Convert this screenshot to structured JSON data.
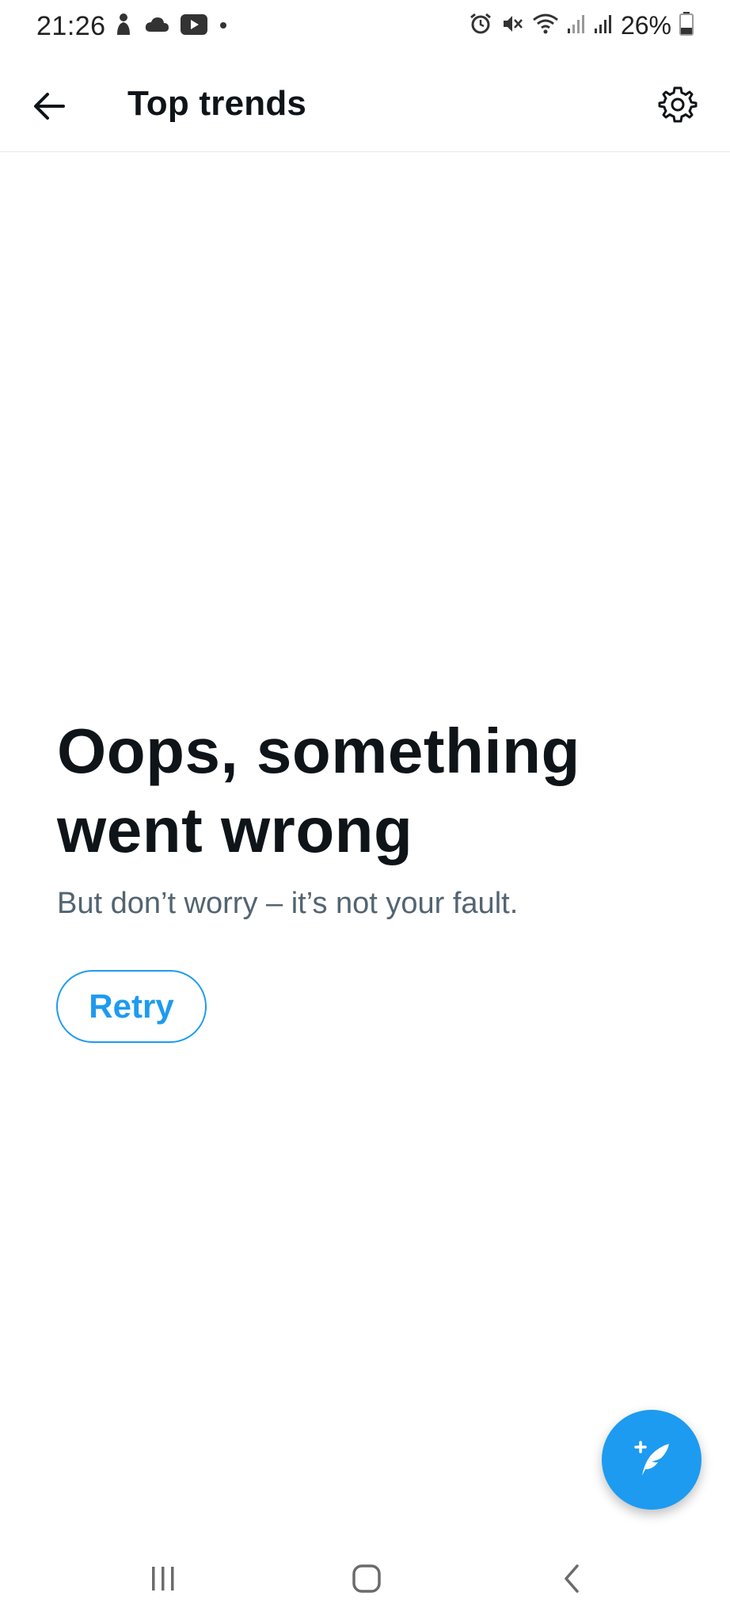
{
  "status_bar": {
    "time": "21:26",
    "battery": "26%",
    "left_icons": [
      "notification-icon",
      "cloud-icon",
      "youtube-icon",
      "dot-icon"
    ],
    "right_icons": [
      "alarm-icon",
      "mute-icon",
      "wifi-icon",
      "signal-icon",
      "signal-icon",
      "battery-icon"
    ]
  },
  "header": {
    "title": "Top trends",
    "back_icon": "arrow-left-icon",
    "settings_icon": "gear-icon"
  },
  "error": {
    "title": "Oops, something went wrong",
    "subtitle": "But don’t worry – it’s not your fault.",
    "retry_label": "Retry"
  },
  "fab": {
    "icon": "compose-feather-icon"
  },
  "nav": {
    "items": [
      "recents-icon",
      "home-icon",
      "back-icon"
    ]
  },
  "colors": {
    "accent": "#1d9bf0",
    "text_primary": "#0f1419",
    "text_secondary": "#536471"
  }
}
